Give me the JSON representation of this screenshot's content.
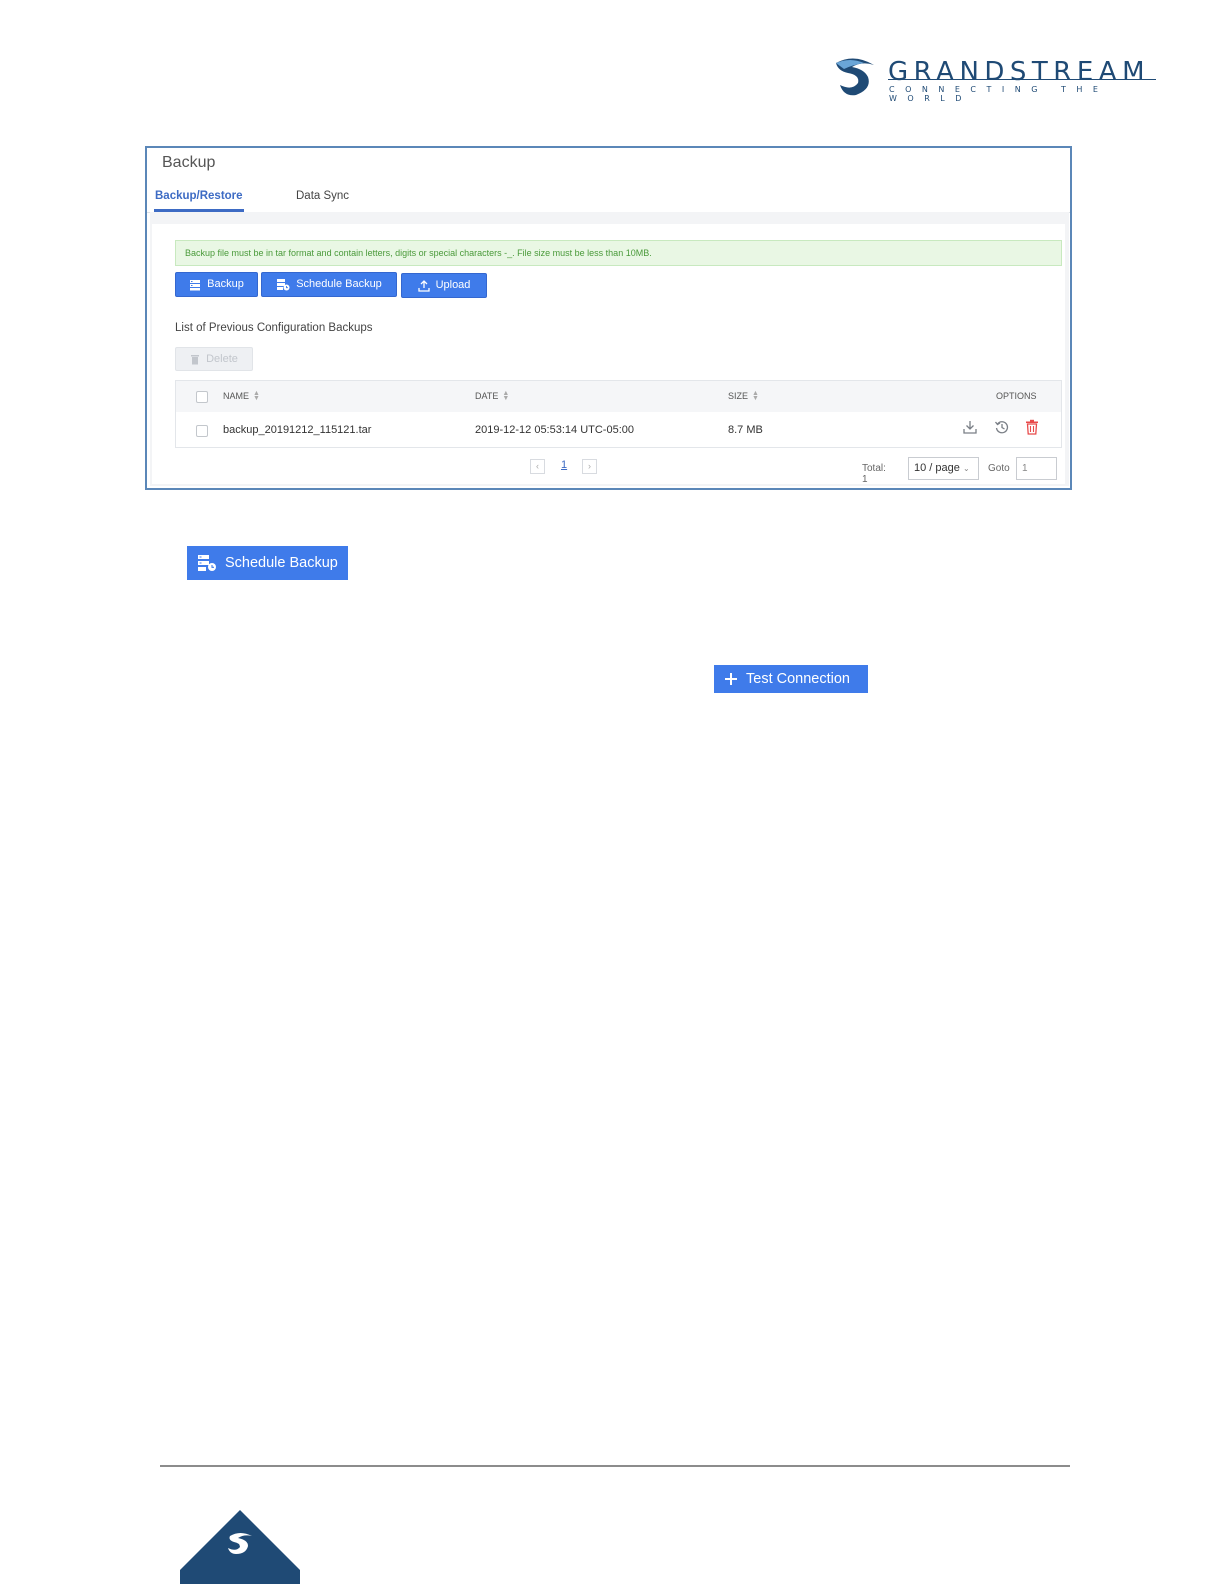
{
  "logo": {
    "word": "GRANDSTREAM",
    "tagline": "CONNECTING THE WORLD"
  },
  "panel": {
    "title": "Backup",
    "tabs": [
      {
        "label": "Backup/Restore",
        "active": true
      },
      {
        "label": "Data Sync",
        "active": false
      }
    ],
    "notice": "Backup file must be in tar format and contain letters, digits or special characters -_. File size must be less than 10MB.",
    "buttons": {
      "backup": "Backup",
      "schedule_backup": "Schedule Backup",
      "upload": "Upload",
      "delete": "Delete"
    },
    "list_title": "List of Previous Configuration Backups",
    "table": {
      "columns": {
        "name": "NAME",
        "date": "DATE",
        "size": "SIZE",
        "options": "OPTIONS"
      },
      "rows": [
        {
          "name": "backup_20191212_115121.tar",
          "date": "2019-12-12 05:53:14 UTC-05:00",
          "size": "8.7 MB",
          "options": [
            "download-icon",
            "restore-icon",
            "delete-icon"
          ]
        }
      ]
    },
    "pagination": {
      "current_page": "1",
      "total": "Total: 1",
      "page_size": "10 / page",
      "goto_label": "Goto",
      "goto_value": "1"
    }
  },
  "standalone": {
    "schedule_backup": "Schedule Backup",
    "test_connection": "Test Connection"
  },
  "colors": {
    "primary": "#3f7bea",
    "brand": "#1f4a75",
    "notice_text": "#4a9a3a",
    "danger": "#e84a4a"
  }
}
